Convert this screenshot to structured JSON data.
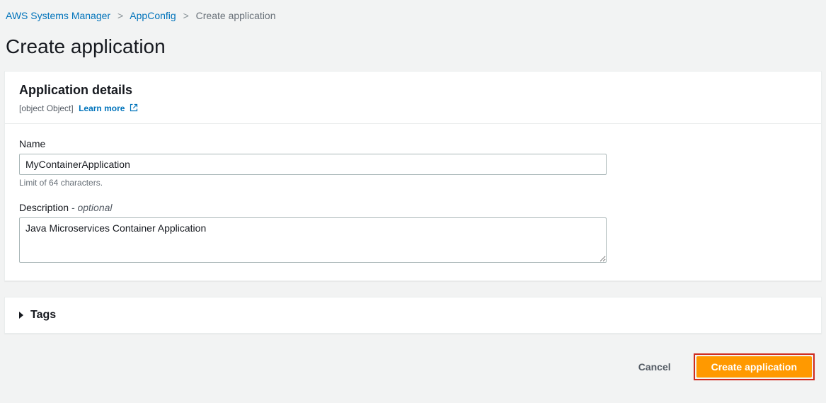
{
  "breadcrumb": {
    "items": [
      {
        "label": "AWS Systems Manager"
      },
      {
        "label": "AppConfig"
      }
    ],
    "current": "Create application"
  },
  "pageTitle": "Create application",
  "detailsPanel": {
    "title": "Application details",
    "description": {
      "label": "Description",
      "optionalSuffix": " - optional",
      "value": "Java Microservices Container Application"
    },
    "learnMore": "Learn more",
    "name": {
      "label": "Name",
      "value": "MyContainerApplication",
      "helper": "Limit of 64 characters."
    }
  },
  "tagsPanel": {
    "label": "Tags"
  },
  "actions": {
    "cancel": "Cancel",
    "create": "Create application"
  }
}
